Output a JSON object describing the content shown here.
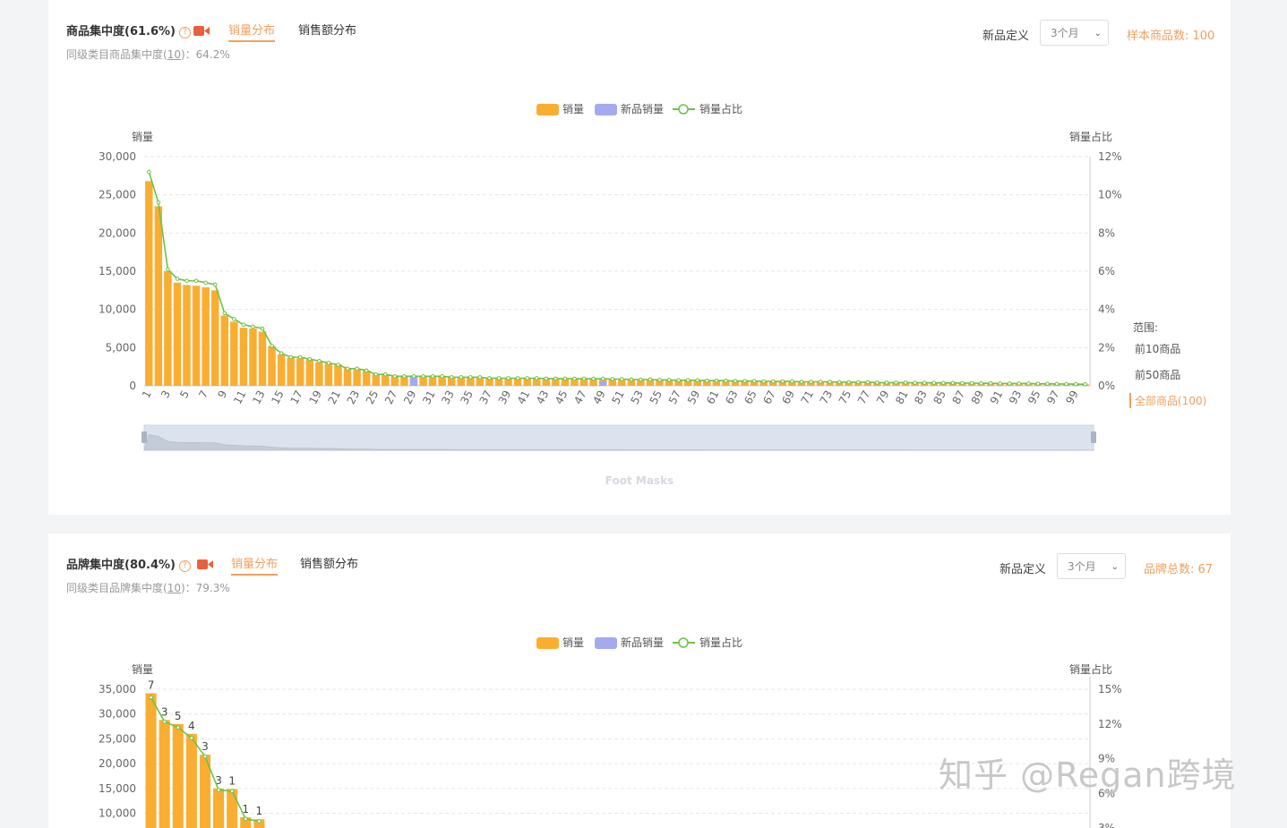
{
  "section1": {
    "title": "商品集中度(61.6%)",
    "help_icon": "question-circle-icon",
    "video_icon": "video-camera-icon",
    "tabs": [
      "销量分布",
      "销售额分布"
    ],
    "active_tab": 0,
    "sub_prefix": "同级类目商品集中度(",
    "sub_link": "10",
    "sub_suffix": ")：64.2%",
    "new_def_label": "新品定义",
    "new_def_value": "3个月",
    "count_label": "样本商品数: 100",
    "range_label": "范围:",
    "range_items": [
      "前10商品",
      "前50商品",
      "全部商品(100)"
    ],
    "range_active": 2,
    "footer_text": "Foot Masks"
  },
  "section2": {
    "title": "品牌集中度(80.4%)",
    "help_icon": "question-circle-icon",
    "video_icon": "video-camera-icon",
    "tabs": [
      "销量分布",
      "销售额分布"
    ],
    "active_tab": 0,
    "sub_prefix": "同级类目品牌集中度(",
    "sub_link": "10",
    "sub_suffix": ")：79.3%",
    "new_def_label": "新品定义",
    "new_def_value": "3个月",
    "count_label": "品牌总数: 67"
  },
  "legend": [
    "销量",
    "新品销量",
    "销量占比"
  ],
  "colors": {
    "sales": "#f9ae32",
    "new_sales": "#a3aaee",
    "ratio": "#6cc24a",
    "accent": "#f0a060"
  },
  "watermark": "知乎 @Regan跨境",
  "chart_data": [
    {
      "type": "bar",
      "title": "",
      "y_left_label": "销量",
      "y_right_label": "销量占比",
      "ylim": [
        0,
        30000
      ],
      "y_ticks": [
        "0",
        "5,000",
        "10,000",
        "15,000",
        "20,000",
        "25,000",
        "30,000"
      ],
      "y2lim": [
        0,
        12
      ],
      "y2_ticks": [
        "0%",
        "2%",
        "4%",
        "6%",
        "8%",
        "10%",
        "12%"
      ],
      "categories_count": 100,
      "x_tick_labels": [
        "1",
        "3",
        "5",
        "7",
        "9",
        "11",
        "13",
        "15",
        "17",
        "19",
        "21",
        "23",
        "25",
        "27",
        "29",
        "31",
        "33",
        "35",
        "37",
        "39",
        "41",
        "43",
        "45",
        "47",
        "49",
        "51",
        "53",
        "55",
        "57",
        "59",
        "61",
        "63",
        "65",
        "67",
        "69",
        "71",
        "73",
        "75",
        "77",
        "79",
        "81",
        "83",
        "85",
        "87",
        "89",
        "91",
        "93",
        "95",
        "97",
        "99"
      ],
      "series": [
        {
          "name": "销量",
          "values": [
            26800,
            23500,
            15000,
            13500,
            13200,
            13100,
            12900,
            12500,
            9200,
            8400,
            7600,
            7500,
            7100,
            5200,
            4100,
            3700,
            3600,
            3500,
            3100,
            3000,
            2800,
            2300,
            2100,
            2000,
            1500,
            1400,
            1300,
            1300,
            1300,
            1200,
            1200,
            1200,
            1100,
            1100,
            1100,
            1100,
            1000,
            1000,
            1000,
            1000,
            1000,
            1000,
            950,
            950,
            950,
            900,
            900,
            900,
            900,
            850,
            850,
            800,
            800,
            800,
            750,
            750,
            700,
            700,
            700,
            650,
            650,
            650,
            600,
            600,
            600,
            550,
            550,
            550,
            550,
            500,
            500,
            500,
            500,
            450,
            450,
            450,
            450,
            400,
            400,
            400,
            400,
            380,
            380,
            380,
            360,
            360,
            340,
            340,
            320,
            320,
            300,
            300,
            280,
            280,
            260,
            260,
            240,
            240,
            220,
            200
          ]
        },
        {
          "name": "新品销量",
          "values": [
            0,
            0,
            0,
            0,
            0,
            0,
            0,
            0,
            0,
            0,
            0,
            0,
            0,
            0,
            0,
            0,
            0,
            0,
            0,
            0,
            0,
            0,
            0,
            0,
            0,
            0,
            0,
            0,
            1200,
            0,
            0,
            0,
            0,
            0,
            0,
            0,
            0,
            0,
            0,
            0,
            0,
            0,
            0,
            0,
            0,
            0,
            0,
            0,
            600,
            0,
            0,
            0,
            0,
            0,
            0,
            0,
            0,
            0,
            0,
            0,
            0,
            0,
            0,
            0,
            0,
            0,
            0,
            0,
            0,
            0,
            0,
            0,
            0,
            0,
            0,
            0,
            0,
            0,
            0,
            0,
            0,
            0,
            0,
            0,
            0,
            0,
            0,
            0,
            0,
            0,
            0,
            0,
            0,
            0,
            0,
            0,
            0,
            0,
            0,
            0
          ]
        },
        {
          "name": "销量占比",
          "axis": "right",
          "values": [
            11.2,
            9.6,
            6.1,
            5.6,
            5.5,
            5.5,
            5.4,
            5.3,
            3.8,
            3.5,
            3.2,
            3.1,
            3.0,
            2.1,
            1.7,
            1.5,
            1.5,
            1.4,
            1.3,
            1.2,
            1.1,
            0.9,
            0.9,
            0.8,
            0.6,
            0.6,
            0.5,
            0.5,
            0.5,
            0.5,
            0.5,
            0.5,
            0.45,
            0.45,
            0.45,
            0.45,
            0.4,
            0.4,
            0.4,
            0.4,
            0.4,
            0.4,
            0.38,
            0.38,
            0.38,
            0.37,
            0.37,
            0.37,
            0.37,
            0.35,
            0.35,
            0.33,
            0.33,
            0.33,
            0.31,
            0.31,
            0.29,
            0.29,
            0.29,
            0.27,
            0.27,
            0.27,
            0.25,
            0.25,
            0.25,
            0.23,
            0.23,
            0.23,
            0.23,
            0.21,
            0.21,
            0.21,
            0.21,
            0.19,
            0.19,
            0.19,
            0.19,
            0.17,
            0.17,
            0.17,
            0.17,
            0.16,
            0.16,
            0.16,
            0.15,
            0.15,
            0.14,
            0.14,
            0.13,
            0.13,
            0.12,
            0.12,
            0.12,
            0.12,
            0.11,
            0.11,
            0.1,
            0.1,
            0.09,
            0.08
          ]
        }
      ]
    },
    {
      "type": "bar",
      "title": "",
      "y_left_label": "销量",
      "y_right_label": "销量占比",
      "ylim": [
        0,
        35000
      ],
      "y_ticks": [
        "10,000",
        "15,000",
        "20,000",
        "25,000",
        "30,000",
        "35,000"
      ],
      "y_tick_values": [
        10000,
        15000,
        20000,
        25000,
        30000,
        35000
      ],
      "y2_ticks": [
        "3%",
        "6%",
        "9%",
        "12%",
        "15%"
      ],
      "y2_tick_values": [
        3,
        6,
        9,
        12,
        15
      ],
      "y2lim": [
        0,
        15
      ],
      "series": [
        {
          "name": "销量",
          "values": [
            34200,
            28800,
            28000,
            26000,
            21800,
            15000,
            14900,
            9200,
            8800
          ]
        },
        {
          "name": "销量占比",
          "axis": "right",
          "values": [
            14.3,
            12.2,
            11.7,
            10.8,
            9.2,
            6.3,
            6.2,
            3.8,
            3.6
          ]
        }
      ],
      "data_labels": [
        "7",
        "3",
        "5",
        "4",
        "3",
        "3",
        "1",
        "1",
        "1"
      ]
    }
  ]
}
